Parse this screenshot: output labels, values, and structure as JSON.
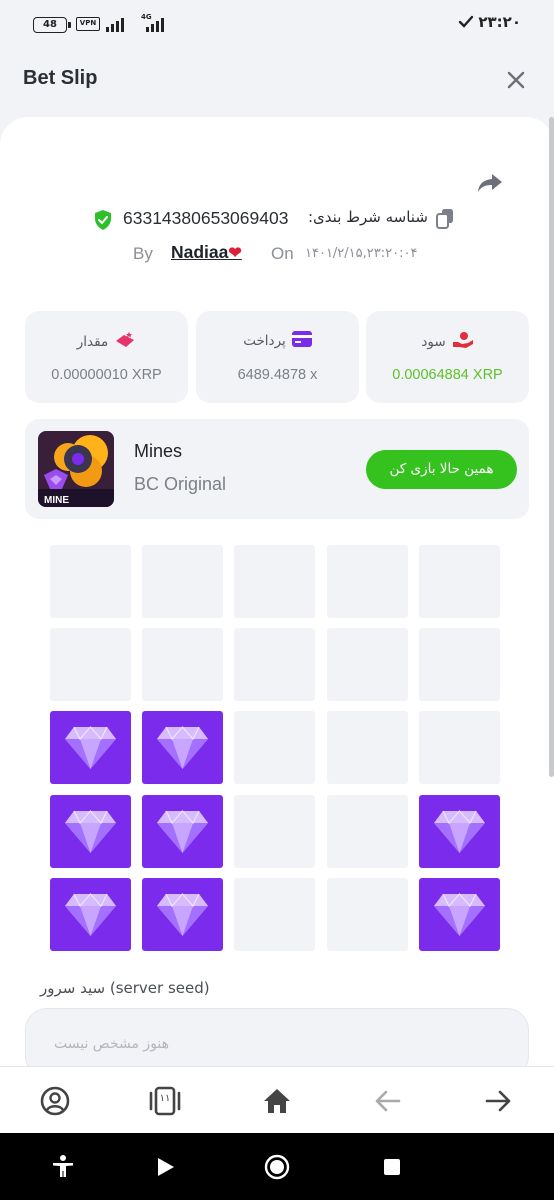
{
  "status_bar": {
    "battery": "48",
    "vpn": "VPN",
    "network": "4G",
    "time": "۲۳:۲۰"
  },
  "header": {
    "title": "Bet Slip"
  },
  "bet": {
    "id_label": "شناسه شرط بندی:",
    "id_value": "63314380653069403",
    "by_label": "By",
    "username": "Nadiaa",
    "heart": "❤",
    "on_label": "On",
    "date": "۱۴۰۱/۲/۱۵,۲۳:۲۰:۰۴"
  },
  "stats": [
    {
      "title": "سود",
      "value": "0.00064884 XRP",
      "icon": "profit-hand-icon",
      "color": "#e02f3a"
    },
    {
      "title": "پرداخت",
      "value": "6489.4878 x",
      "icon": "payment-card-icon",
      "color": "#7a2bec"
    },
    {
      "title": "مقدار",
      "value": "0.00000010 XRP",
      "icon": "amount-coins-icon",
      "color": "#e6336b"
    }
  ],
  "game": {
    "name": "Mines",
    "subtitle": "BC Original",
    "thumb_label": "MINE",
    "play_label": "همین حالا بازی کن"
  },
  "mines_grid": {
    "rows": 5,
    "cols": 5,
    "gems": [
      [
        2,
        0
      ],
      [
        2,
        1
      ],
      [
        3,
        0
      ],
      [
        3,
        1
      ],
      [
        3,
        4
      ],
      [
        4,
        0
      ],
      [
        4,
        1
      ],
      [
        4,
        4
      ]
    ]
  },
  "server_seed": {
    "label": "سید سرور (server seed)",
    "placeholder": "هنوز مشخص نیست"
  },
  "bottom_nav": {
    "tabs_count": "۱۱"
  },
  "colors": {
    "accent_purple": "#7a2bec",
    "play_green": "#35c21f",
    "profit_green": "#5cc22a"
  }
}
